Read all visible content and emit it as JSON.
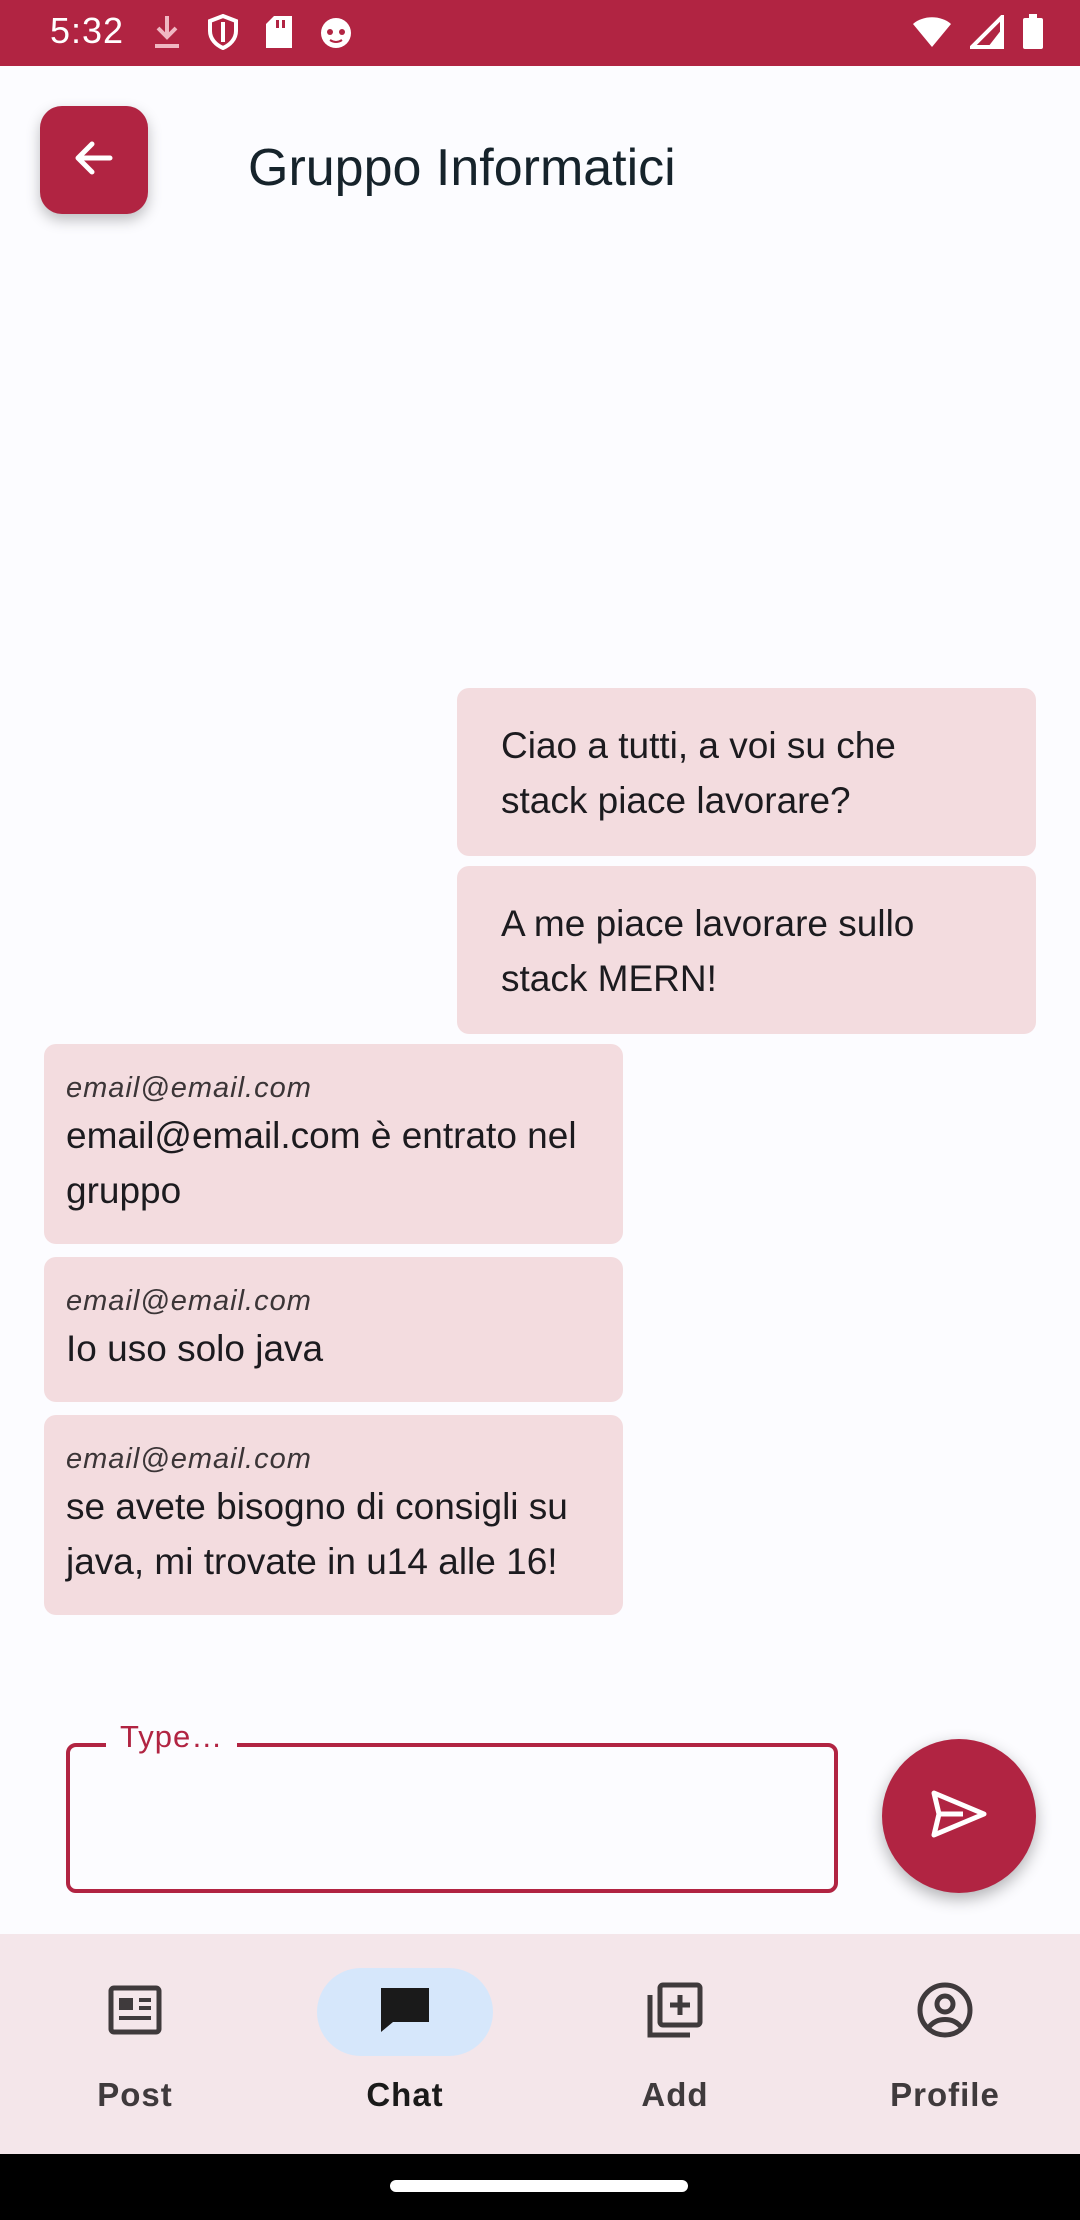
{
  "status_bar": {
    "time": "5:32",
    "left_icons": [
      "download-icon",
      "shield-icon",
      "sd-card-icon",
      "cat-face-icon"
    ],
    "right_icons": [
      "wifi-icon",
      "cell-signal-icon",
      "battery-icon"
    ],
    "color": "#b12442"
  },
  "header": {
    "title": "Gruppo Informatici",
    "back_icon": "arrow-left-icon"
  },
  "messages": [
    {
      "mine": true,
      "text": "Ciao a tutti, a voi su che stack piace lavorare?"
    },
    {
      "mine": true,
      "text": "A me piace lavorare sullo stack MERN!"
    },
    {
      "mine": false,
      "sender": "email@email.com",
      "text": "email@email.com è entrato nel gruppo"
    },
    {
      "mine": false,
      "sender": "email@email.com",
      "text": "Io uso solo java"
    },
    {
      "mine": false,
      "sender": "email@email.com",
      "text": "se avete bisogno di consigli su java, mi trovate in u14 alle 16!"
    }
  ],
  "composer": {
    "label": "Type…",
    "value": "",
    "send_icon": "send-icon"
  },
  "bottom_nav": {
    "items": [
      {
        "label": "Post",
        "icon": "newspaper-icon",
        "active": false
      },
      {
        "label": "Chat",
        "icon": "chat-bubble-icon",
        "active": true
      },
      {
        "label": "Add",
        "icon": "add-copy-icon",
        "active": false
      },
      {
        "label": "Profile",
        "icon": "account-circle-icon",
        "active": false
      }
    ]
  },
  "colors": {
    "accent": "#b12442",
    "bubble": "#f3dcdf",
    "nav_background": "#f4e6ea",
    "active_pill": "#d6e7fb"
  }
}
